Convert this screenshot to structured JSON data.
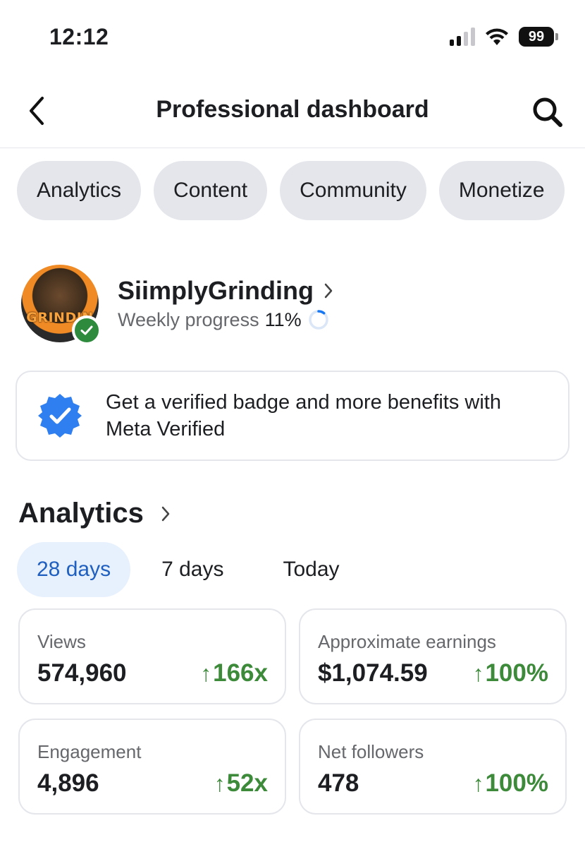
{
  "status_bar": {
    "time": "12:12",
    "battery": "99",
    "icons": [
      "signal-icon",
      "wifi-icon",
      "battery-icon"
    ]
  },
  "header": {
    "title": "Professional dashboard",
    "icons": [
      "back-chevron-icon",
      "search-icon"
    ]
  },
  "tabs": [
    "Analytics",
    "Content",
    "Community",
    "Monetize"
  ],
  "profile": {
    "name": "SiimplyGrinding",
    "progress_label": "Weekly progress",
    "progress_value": "11%",
    "progress_fraction": 0.11,
    "avatar_text": "GRINDIN"
  },
  "banner": {
    "text": "Get a verified badge and more benefits with Meta Verified",
    "icon": "verified-badge-icon"
  },
  "analytics": {
    "title": "Analytics",
    "ranges": [
      "28 days",
      "7 days",
      "Today"
    ],
    "selected_range": "28 days",
    "cards": [
      {
        "label": "Views",
        "value": "574,960",
        "change": "166x"
      },
      {
        "label": "Approximate earnings",
        "value": "$1,074.59",
        "change": "100%"
      },
      {
        "label": "Engagement",
        "value": "4,896",
        "change": "52x"
      },
      {
        "label": "Net followers",
        "value": "478",
        "change": "100%"
      }
    ]
  },
  "colors": {
    "accent_blue": "#1f5fbf",
    "positive_green": "#3c8a3a",
    "verified_green": "#2e8b3d",
    "chip_gray": "#e4e6eb"
  }
}
